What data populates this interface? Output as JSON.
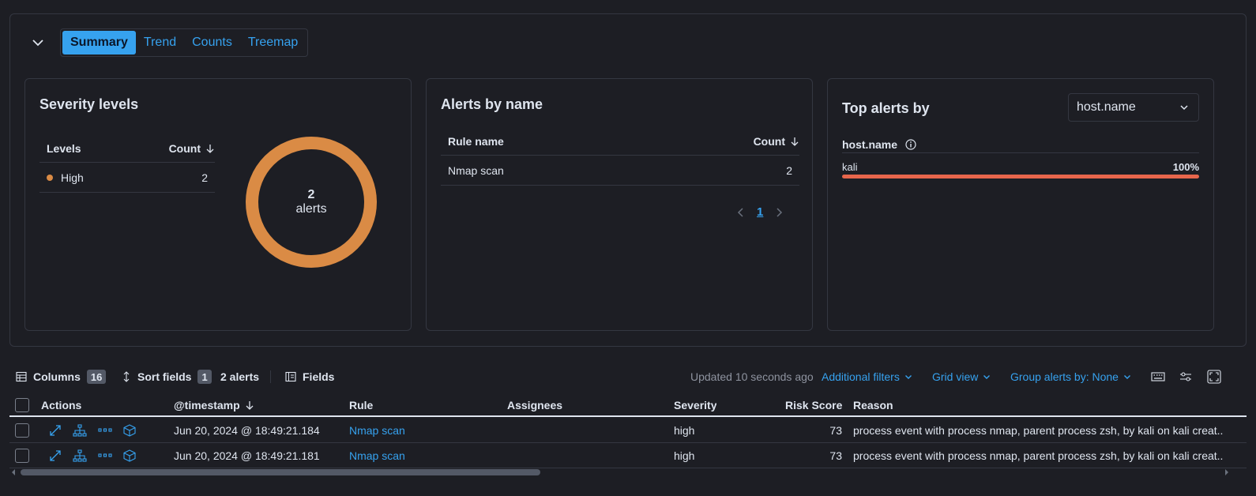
{
  "tabs": [
    "Summary",
    "Trend",
    "Counts",
    "Treemap"
  ],
  "severity": {
    "title": "Severity levels",
    "col_levels": "Levels",
    "col_count": "Count",
    "rows": [
      {
        "level": "High",
        "count": "2",
        "color": "#da8b45"
      }
    ],
    "donut_count": "2",
    "donut_label": "alerts",
    "donut_color": "#da8b45"
  },
  "alerts_by_name": {
    "title": "Alerts by name",
    "col_rule": "Rule name",
    "col_count": "Count",
    "rows": [
      {
        "name": "Nmap scan",
        "count": "2"
      }
    ],
    "page": "1"
  },
  "top_alerts": {
    "title": "Top alerts by",
    "select_value": "host.name",
    "field_header": "host.name",
    "rows": [
      {
        "name": "kali",
        "percent": "100%",
        "fraction": 1.0,
        "color": "#e7664c"
      }
    ]
  },
  "toolbar": {
    "columns_label": "Columns",
    "columns_count": "16",
    "sort_label": "Sort fields",
    "sort_count": "1",
    "alerts_count": "2 alerts",
    "fields_label": "Fields",
    "updated": "Updated 10 seconds ago",
    "additional_filters": "Additional filters",
    "grid_view": "Grid view",
    "group_by": "Group alerts by: None"
  },
  "grid": {
    "headers": {
      "actions": "Actions",
      "timestamp": "@timestamp",
      "rule": "Rule",
      "assignees": "Assignees",
      "severity": "Severity",
      "risk": "Risk Score",
      "reason": "Reason"
    },
    "rows": [
      {
        "timestamp": "Jun 20, 2024 @ 18:49:21.184",
        "rule": "Nmap scan",
        "assignees": "",
        "severity": "high",
        "risk": "73",
        "reason": "process event with process nmap, parent process zsh, by kali on kali creat.."
      },
      {
        "timestamp": "Jun 20, 2024 @ 18:49:21.181",
        "rule": "Nmap scan",
        "assignees": "",
        "severity": "high",
        "risk": "73",
        "reason": "process event with process nmap, parent process zsh, by kali on kali creat.."
      }
    ]
  },
  "colors": {
    "accent": "#36a2ef",
    "background": "#1d1e24",
    "border": "#343741"
  }
}
